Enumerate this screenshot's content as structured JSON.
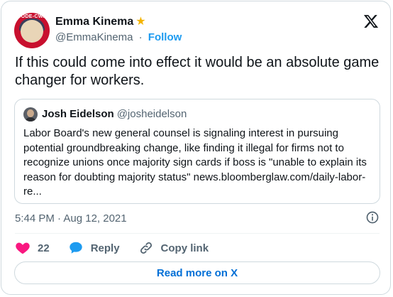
{
  "author": {
    "name": "Emma Kinema",
    "handle": "@EmmaKinema",
    "follow_label": "Follow",
    "separator": "·",
    "badge_icon": "star-icon",
    "avatar_text": "CODE-CWA"
  },
  "tweet": {
    "text": "If this could come into effect it would be an absolute game changer for workers."
  },
  "quote": {
    "name": "Josh Eidelson",
    "handle": "@josheidelson",
    "text": "Labor Board's new general counsel is signaling interest in pursuing potential groundbreaking change, like finding it illegal for firms not to recognize unions once majority sign cards if boss is \"unable to explain its reason for doubting majority status\" news.bloomberglaw.com/daily-labor-re..."
  },
  "meta": {
    "timestamp": "5:44 PM · Aug 12, 2021"
  },
  "actions": {
    "like_count": "22",
    "reply_label": "Reply",
    "copy_link_label": "Copy link"
  },
  "footer": {
    "read_more_label": "Read more on X"
  },
  "colors": {
    "link": "#1d9bf0",
    "like": "#f91880",
    "reply": "#1d9bf0",
    "read_more": "#006fd6"
  }
}
